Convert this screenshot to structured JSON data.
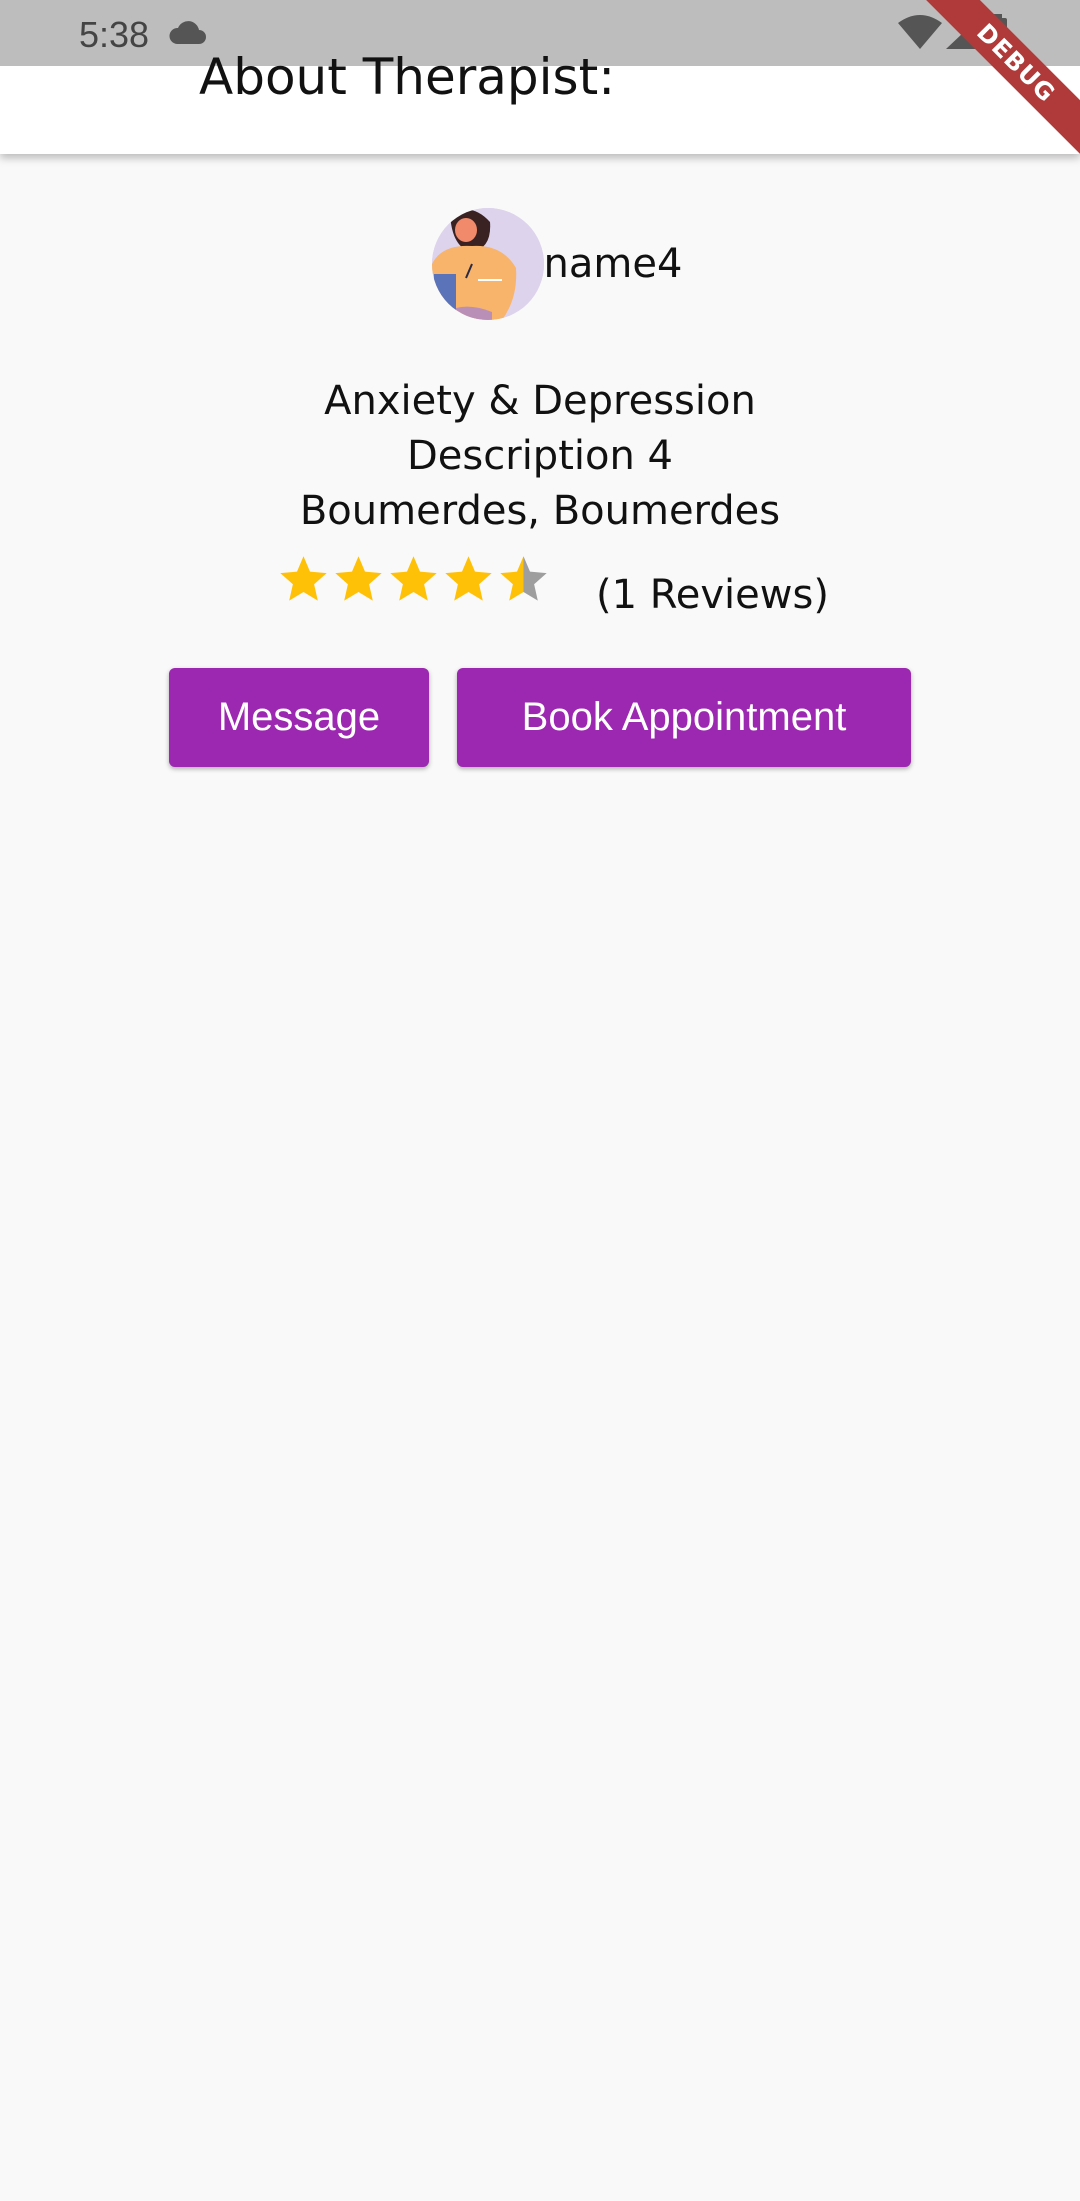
{
  "status_bar": {
    "time": "5:38",
    "icons": [
      "cloud-icon",
      "wifi-icon",
      "signal-icon",
      "battery-icon"
    ]
  },
  "app_bar": {
    "title": "About Therapist:"
  },
  "debug_banner": {
    "label": "DEBUG",
    "color": "#b03a3a"
  },
  "therapist": {
    "name": "name4",
    "specialty": "Anxiety & Depression",
    "description": "Description 4",
    "location": "Boumerdes, Boumerdes",
    "rating": 4.5,
    "rating_max": 5,
    "reviews_text": "(1 Reviews)"
  },
  "actions": {
    "message_label": "Message",
    "book_label": "Book Appointment"
  },
  "colors": {
    "accent": "#9c27b0",
    "star_filled": "#ffc107",
    "star_empty": "#9e9e9e",
    "background": "#f9f9f9"
  }
}
